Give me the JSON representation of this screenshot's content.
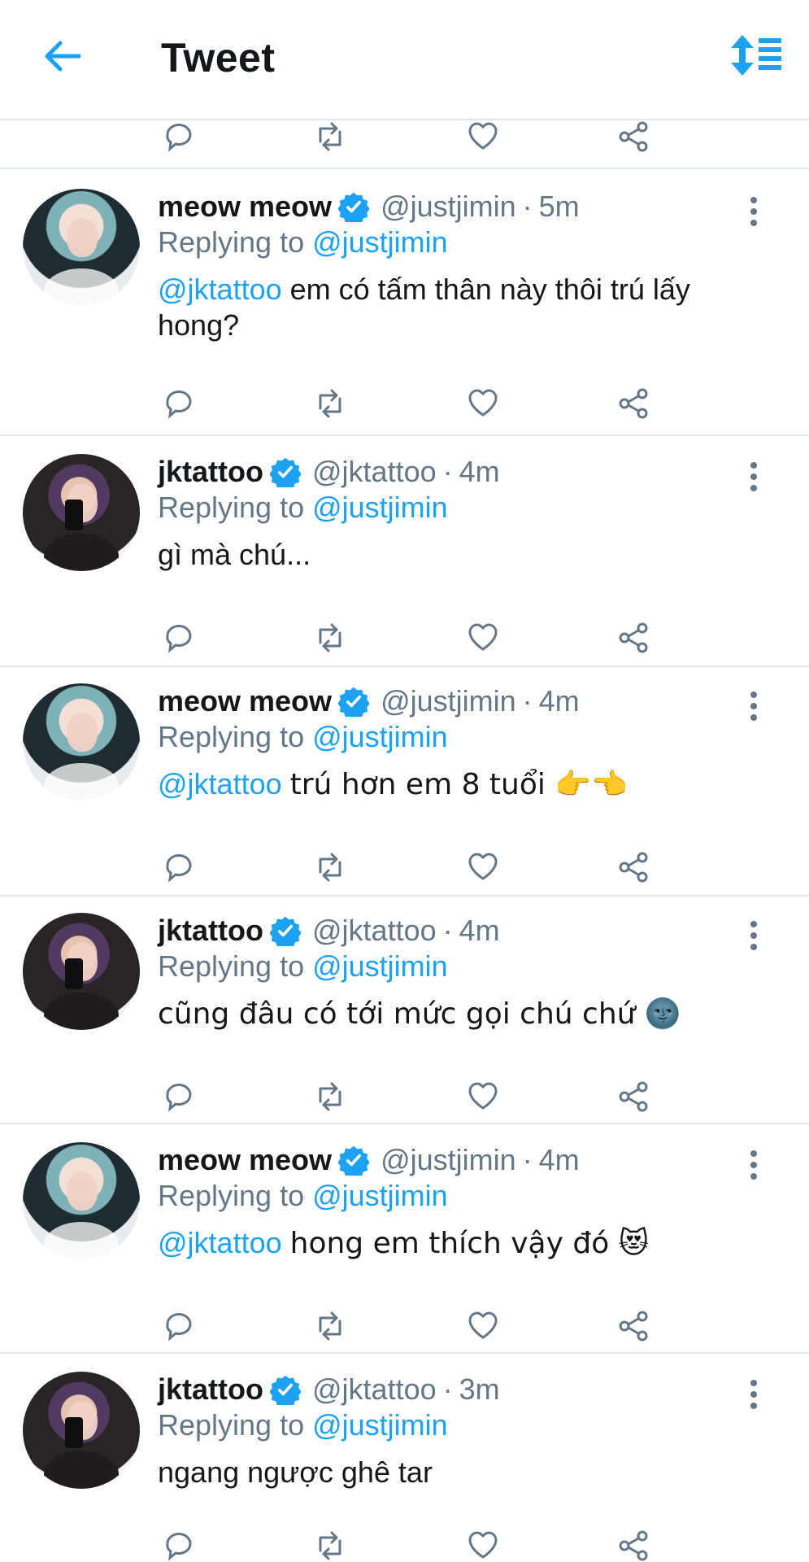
{
  "header": {
    "title": "Tweet",
    "back_icon": "arrow-left-icon",
    "sort_icon": "sort-icon"
  },
  "colors": {
    "accent": "#1da1f2",
    "text": "#14171a",
    "muted": "#657786",
    "divider": "#e1e8ed"
  },
  "tweets": [
    {
      "name": "meow meow",
      "handle": "@justjimin",
      "time": "5m",
      "reply_label": "Replying to",
      "reply_to": "@justjimin",
      "mention": "@jktattoo",
      "text": "em có tấm thân này thôi trú lấy hong?"
    },
    {
      "name": "jktattoo",
      "handle": "@jktattoo",
      "time": "4m",
      "reply_label": "Replying to",
      "reply_to": "@justjimin",
      "mention": "",
      "text": "gì mà chú..."
    },
    {
      "name": "meow meow",
      "handle": "@justjimin",
      "time": "4m",
      "reply_label": "Replying to",
      "reply_to": "@justjimin",
      "mention": "@jktattoo",
      "text": "trú hơn em 8 tuổi 👉👈"
    },
    {
      "name": "jktattoo",
      "handle": "@jktattoo",
      "time": "4m",
      "reply_label": "Replying to",
      "reply_to": "@justjimin",
      "mention": "",
      "text": "cũng đâu có tới mức gọi chú chứ 🌚"
    },
    {
      "name": "meow meow",
      "handle": "@justjimin",
      "time": "4m",
      "reply_label": "Replying to",
      "reply_to": "@justjimin",
      "mention": "@jktattoo",
      "text": "hong em thích vậy đó 😻"
    },
    {
      "name": "jktattoo",
      "handle": "@jktattoo",
      "time": "3m",
      "reply_label": "Replying to",
      "reply_to": "@justjimin",
      "mention": "",
      "text": "ngang ngược ghê tar"
    }
  ]
}
